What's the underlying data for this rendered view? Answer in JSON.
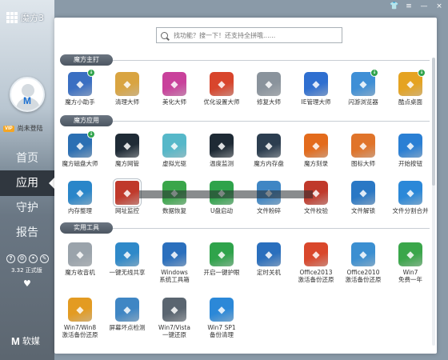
{
  "app": {
    "title": "魔方3"
  },
  "window_controls": [
    "👕",
    "≡",
    "—",
    "×"
  ],
  "sidebar": {
    "login_text": "尚未登陆",
    "vip_badge": "VIP",
    "nav": [
      {
        "label": "首页",
        "active": false
      },
      {
        "label": "应用",
        "active": true
      },
      {
        "label": "守护",
        "active": false
      },
      {
        "label": "报告",
        "active": false
      }
    ],
    "version": "3.32 正式版",
    "vendor": "软媒",
    "vendor_mark": "M"
  },
  "search": {
    "placeholder": "找功能？搜一下！还支持全拼哦......",
    "value": ""
  },
  "sections": [
    {
      "title": "魔方主打",
      "items": [
        {
          "label": "魔方小助手",
          "icon": "assistant-icon",
          "color": "#3a6fc2",
          "badge": true
        },
        {
          "label": "清理大师",
          "icon": "broom-icon",
          "color": "#d9a441",
          "badge": false
        },
        {
          "label": "美化大师",
          "icon": "brush-icon",
          "color": "#c9419b",
          "badge": false
        },
        {
          "label": "优化设置大师",
          "icon": "rocket-icon",
          "color": "#d8452c",
          "badge": false
        },
        {
          "label": "修复大师",
          "icon": "wrench-icon",
          "color": "#8a939c",
          "badge": false
        },
        {
          "label": "IE管理大师",
          "icon": "ie-icon",
          "color": "#2f6fd0",
          "badge": false
        },
        {
          "label": "闪游浏览器",
          "icon": "browser-icon",
          "color": "#3f8fd6",
          "badge": true
        },
        {
          "label": "酷点桌面",
          "icon": "desktop-icon",
          "color": "#e5a321",
          "badge": true
        }
      ]
    },
    {
      "title": "魔方应用",
      "items": [
        {
          "label": "魔方磁盘大师",
          "icon": "disk-icon",
          "color": "#2b6fb3",
          "badge": true
        },
        {
          "label": "魔方网管",
          "icon": "speedometer-icon",
          "color": "#1f2b36",
          "badge": false
        },
        {
          "label": "虚拟光驱",
          "icon": "disc-icon",
          "color": "#56b8c9",
          "badge": false
        },
        {
          "label": "温度监测",
          "icon": "thermometer-icon",
          "color": "#1e2a35",
          "badge": false
        },
        {
          "label": "魔方内存盘",
          "icon": "chip-icon",
          "color": "#2c3e50",
          "badge": false
        },
        {
          "label": "魔方刻录",
          "icon": "burn-icon",
          "color": "#e36b1c",
          "badge": false
        },
        {
          "label": "图标大师",
          "icon": "icon-master-icon",
          "color": "#e0742a",
          "badge": false
        },
        {
          "label": "开始按钮",
          "icon": "start-button-icon",
          "color": "#2a7fd4",
          "badge": false
        },
        {
          "label": "内存整理",
          "icon": "memory-icon",
          "color": "#2a86c9",
          "badge": false
        },
        {
          "label": "网址监控",
          "icon": "spy-icon",
          "color": "#c0392b",
          "badge": false,
          "selected": true
        },
        {
          "label": "数据恢复",
          "icon": "recover-icon",
          "color": "#3aa64a",
          "badge": false
        },
        {
          "label": "U盘启动",
          "icon": "usb-icon",
          "color": "#2fa34b",
          "badge": false
        },
        {
          "label": "文件粉碎",
          "icon": "shredder-icon",
          "color": "#3f86c4",
          "badge": false
        },
        {
          "label": "文件校验",
          "icon": "verify-icon",
          "color": "#c0392b",
          "badge": false
        },
        {
          "label": "文件解锁",
          "icon": "unlock-icon",
          "color": "#2a78c5",
          "badge": false
        },
        {
          "label": "文件分割合并",
          "icon": "split-icon",
          "color": "#2b88d8",
          "badge": false
        }
      ]
    },
    {
      "title": "实用工具",
      "items": [
        {
          "label": "魔方收音机",
          "label2": "",
          "icon": "radio-icon",
          "color": "#9aa3ab",
          "badge": false
        },
        {
          "label": "一键无线共享",
          "label2": "",
          "icon": "wifi-icon",
          "color": "#2f89c9",
          "badge": false
        },
        {
          "label": "Windows",
          "label2": "系统工具箱",
          "icon": "windows-toolbox-icon",
          "color": "#2a6fbd",
          "badge": false
        },
        {
          "label": "开启一键护眼",
          "label2": "",
          "icon": "eye-icon",
          "color": "#2fa34b",
          "badge": false
        },
        {
          "label": "定时关机",
          "label2": "",
          "icon": "power-icon",
          "color": "#2a6fbd",
          "badge": false
        },
        {
          "label": "Office2013",
          "label2": "激活备份还原",
          "icon": "office2013-icon",
          "color": "#d9472b",
          "badge": false
        },
        {
          "label": "Office2010",
          "label2": "激活备份还原",
          "icon": "office2010-icon",
          "color": "#3b8fd1",
          "badge": false
        },
        {
          "label": "Win7",
          "label2": "免费一年",
          "icon": "win7-icon",
          "color": "#3aa64a",
          "badge": false
        },
        {
          "label": "Win7/Win8",
          "label2": "激活备份还原",
          "icon": "activate-icon",
          "color": "#e39b22",
          "badge": false
        },
        {
          "label": "屏幕坏点检测",
          "label2": "",
          "icon": "monitor-icon",
          "color": "#3f86c4",
          "badge": false
        },
        {
          "label": "Win7/Vista",
          "label2": "一键还原",
          "icon": "restore-icon",
          "color": "#5a6570",
          "badge": false
        },
        {
          "label": "Win7 SP1",
          "label2": "备份清理",
          "icon": "cleanup-icon",
          "color": "#2b88d8",
          "badge": false
        }
      ]
    }
  ]
}
